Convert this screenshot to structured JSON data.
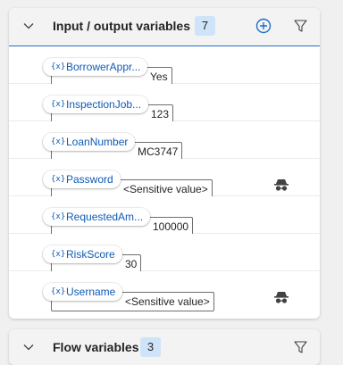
{
  "io_panel": {
    "title": "Input / output variables",
    "count": "7",
    "icons": {
      "collapse": "chevron-down-icon",
      "add": "add-circle-icon",
      "filter": "filter-icon"
    },
    "variables": [
      {
        "name": "BorrowerAppr...",
        "value": "Yes",
        "sensitive": false
      },
      {
        "name": "InspectionJob...",
        "value": "123",
        "sensitive": false
      },
      {
        "name": "LoanNumber",
        "value": "MC3747",
        "sensitive": false
      },
      {
        "name": "Password",
        "value": "<Sensitive value>",
        "sensitive": true
      },
      {
        "name": "RequestedAm...",
        "value": "100000",
        "sensitive": false
      },
      {
        "name": "RiskScore",
        "value": "30",
        "sensitive": false
      },
      {
        "name": "Username",
        "value": "<Sensitive value>",
        "sensitive": true
      }
    ],
    "chip_icon_text": "{x}"
  },
  "flow_panel": {
    "title": "Flow variables",
    "count": "3"
  },
  "colors": {
    "accent": "#1d6ec9",
    "variable_text": "#0f5bb5",
    "badge_bg": "#cfe4f8"
  }
}
